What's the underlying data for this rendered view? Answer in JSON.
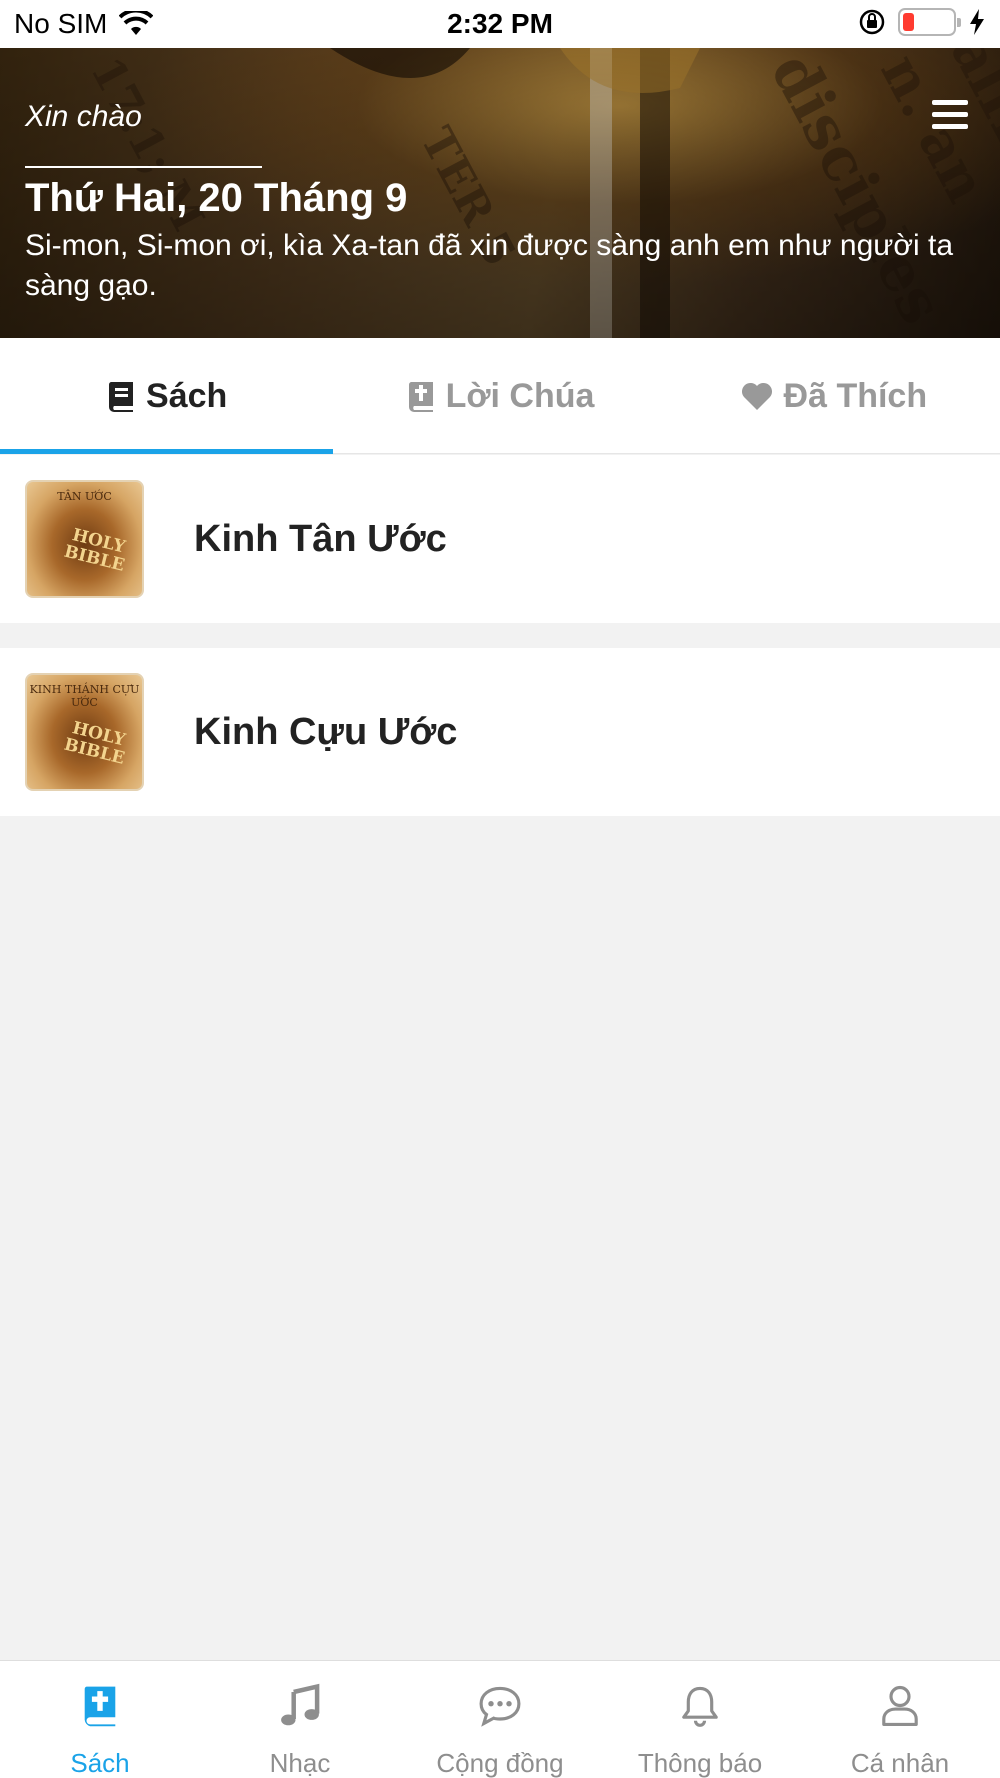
{
  "status_bar": {
    "carrier": "No SIM",
    "time": "2:32 PM"
  },
  "header": {
    "greeting": "Xin chào",
    "date": "Thứ Hai, 20 Tháng 9",
    "verse": "Si-mon, Si-mon ơi, kìa Xa-tan đã xin được sàng anh em như người ta sàng gạo."
  },
  "tabs": [
    {
      "label": "Sách",
      "icon": "book-icon",
      "active": true
    },
    {
      "label": "Lời Chúa",
      "icon": "bible-cross-icon",
      "active": false
    },
    {
      "label": "Đã Thích",
      "icon": "heart-icon",
      "active": false
    }
  ],
  "books": [
    {
      "title": "Kinh Tân Ước",
      "cover_top": "TÂN ƯỚC",
      "cover_text": "HOLY BIBLE"
    },
    {
      "title": "Kinh Cựu Ước",
      "cover_top": "KINH THÁNH CỰU ƯỚC",
      "cover_text": "HOLY BIBLE"
    }
  ],
  "bottom_nav": [
    {
      "label": "Sách",
      "icon": "bible-icon",
      "active": true
    },
    {
      "label": "Nhạc",
      "icon": "music-note-icon",
      "active": false
    },
    {
      "label": "Cộng đồng",
      "icon": "chat-bubble-icon",
      "active": false
    },
    {
      "label": "Thông báo",
      "icon": "bell-icon",
      "active": false
    },
    {
      "label": "Cá nhân",
      "icon": "user-icon",
      "active": false
    }
  ],
  "colors": {
    "accent": "#1aa3e8",
    "inactive": "#8e8e8e",
    "background": "#f2f2f2"
  }
}
